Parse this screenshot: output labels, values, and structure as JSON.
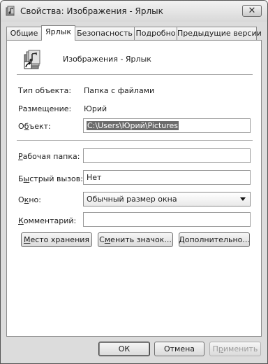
{
  "window": {
    "title": "Свойства: Изображения - Ярлык",
    "close_glyph": "✕"
  },
  "tabs": [
    {
      "label": "Общие",
      "active": false
    },
    {
      "label": "Ярлык",
      "active": true
    },
    {
      "label": "Безопасность",
      "active": false
    },
    {
      "label": "Подробно",
      "active": false
    },
    {
      "label": "Предыдущие версии",
      "active": false
    }
  ],
  "shortcut": {
    "name": "Изображения - Ярлык",
    "icon": "folder-shortcut-icon"
  },
  "info": {
    "type_label": "Тип объекта:",
    "type_value": "Папка с файлами",
    "location_label": "Размещение:",
    "location_value": "Юрий"
  },
  "fields": {
    "target_label_pre": "О",
    "target_label_u": "б",
    "target_label_post": "ъект:",
    "target_value": "C:\\Users\\Юрий\\Pictures",
    "startin_label_u": "Р",
    "startin_label_post": "абочая папка:",
    "startin_value": "",
    "hotkey_label_pre": "Б",
    "hotkey_label_u": "ы",
    "hotkey_label_post": "стрый вызов:",
    "hotkey_value": "Нет",
    "run_label_pre": "О",
    "run_label_u": "к",
    "run_label_post": "но:",
    "run_value": "Обычный размер окна",
    "comment_label_u": "К",
    "comment_label_post": "омментарий:",
    "comment_value": ""
  },
  "buttons": {
    "open_location_u": "М",
    "open_location_post": "есто хранения",
    "change_icon_pre": "С",
    "change_icon_u": "м",
    "change_icon_post": "енить значок...",
    "advanced_u": "Д",
    "advanced_post": "ополнительно..."
  },
  "footer": {
    "ok": "ОК",
    "cancel": "Отмена",
    "apply_pre": "П",
    "apply_u": "р",
    "apply_post": "именить"
  }
}
